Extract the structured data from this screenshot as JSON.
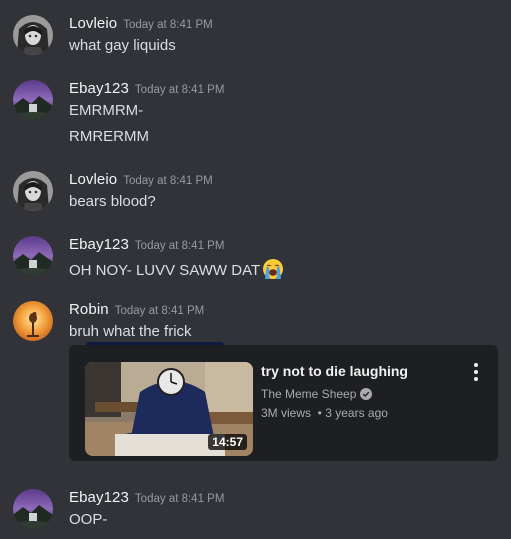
{
  "messages": [
    {
      "username": "Lovleio",
      "timestamp": "Today at 8:41 PM",
      "lines": [
        "what gay liquids"
      ],
      "avatar": "anime-girl-avatar"
    },
    {
      "username": "Ebay123",
      "timestamp": "Today at 8:41 PM",
      "lines": [
        "EMRMRM-",
        "RMRERMM"
      ],
      "avatar": "purple-sky-landscape-avatar"
    },
    {
      "username": "Lovleio",
      "timestamp": "Today at 8:41 PM",
      "lines": [
        "bears blood?"
      ],
      "avatar": "anime-girl-avatar"
    },
    {
      "username": "Ebay123",
      "timestamp": "Today at 8:41 PM",
      "lines": [
        "OH NOY- LUVV SAWW DAT"
      ],
      "emoji": "loudly-crying-face",
      "avatar": "purple-sky-landscape-avatar"
    },
    {
      "username": "Robin",
      "timestamp": "Today at 8:41 PM",
      "lines": [
        "bruh what the frick"
      ],
      "avatar": "orange-sunset-bird-avatar"
    },
    {
      "username": "Ebay123",
      "timestamp": "Today at 8:41 PM",
      "lines": [
        "OOP-"
      ],
      "avatar": "purple-sky-landscape-avatar"
    }
  ],
  "embed": {
    "title": "try not to die laughing",
    "channel": "The Meme Sheep",
    "stats": "3M views  • 3 years ago",
    "duration": "14:57",
    "thumbnail": "clock-head-figure-thumbnail"
  },
  "colors": {
    "background": "#313338",
    "embed_background": "#1e1f22",
    "username": "#f2f3f5",
    "timestamp": "#949ba4",
    "text": "#dbdee1"
  }
}
